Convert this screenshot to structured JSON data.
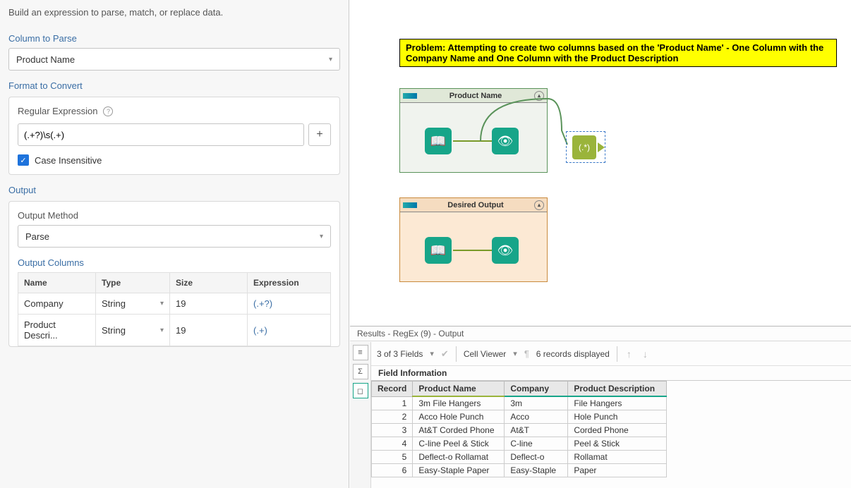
{
  "left": {
    "instruction": "Build an expression to parse, match, or replace data.",
    "column_to_parse_label": "Column to Parse",
    "column_to_parse_value": "Product Name",
    "format_to_convert_label": "Format to Convert",
    "regex_label": "Regular Expression",
    "regex_value": "(.+?)\\s(.+)",
    "case_insensitive_label": "Case Insensitive",
    "output_label": "Output",
    "output_method_label": "Output Method",
    "output_method_value": "Parse",
    "output_columns_label": "Output Columns",
    "cols": {
      "headers": [
        "Name",
        "Type",
        "Size",
        "Expression"
      ],
      "rows": [
        {
          "name": "Company",
          "type": "String",
          "size": "19",
          "expr": "(.+?)"
        },
        {
          "name": "Product Descri...",
          "type": "String",
          "size": "19",
          "expr": "(.+)"
        }
      ]
    }
  },
  "canvas": {
    "problem": "Problem:  Attempting to create two columns based on the 'Product Name' - One Column with the Company Name and One Column with the Product Description",
    "container1_title": "Product Name",
    "container2_title": "Desired Output",
    "regex_badge": "(.*)"
  },
  "results": {
    "title": "Results - RegEx (9) - Output",
    "fields_text": "3 of 3 Fields",
    "cell_viewer": "Cell Viewer",
    "records_text": "6 records displayed",
    "field_info": "Field Information",
    "headers": [
      "Record",
      "Product Name",
      "Company",
      "Product Description"
    ],
    "rows": [
      {
        "rec": "1",
        "pn": "3m File Hangers",
        "co": "3m",
        "pd": "File Hangers"
      },
      {
        "rec": "2",
        "pn": "Acco Hole Punch",
        "co": "Acco",
        "pd": "Hole Punch"
      },
      {
        "rec": "3",
        "pn": "At&T Corded Phone",
        "co": "At&T",
        "pd": "Corded Phone"
      },
      {
        "rec": "4",
        "pn": "C-line Peel & Stick",
        "co": "C-line",
        "pd": "Peel & Stick"
      },
      {
        "rec": "5",
        "pn": "Deflect-o Rollamat",
        "co": "Deflect-o",
        "pd": "Rollamat"
      },
      {
        "rec": "6",
        "pn": "Easy-Staple Paper",
        "co": "Easy-Staple",
        "pd": "Paper"
      }
    ]
  }
}
